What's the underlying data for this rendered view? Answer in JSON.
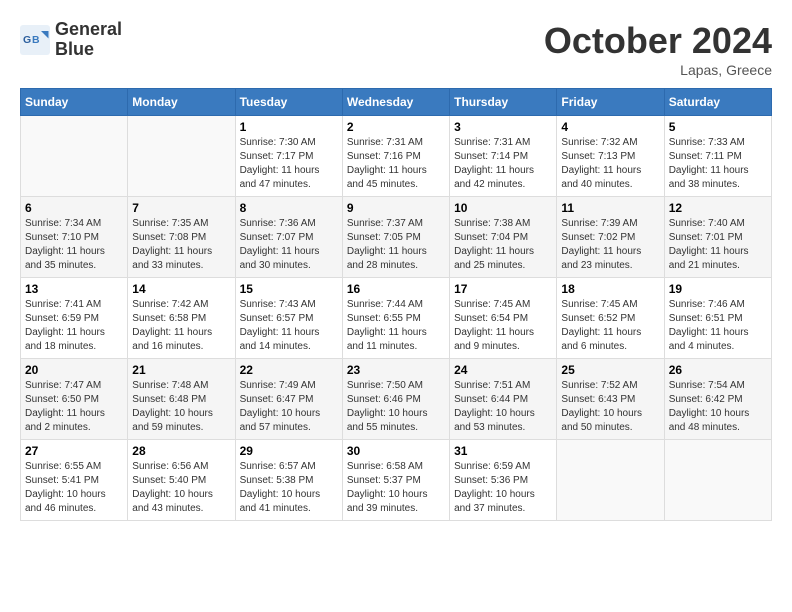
{
  "header": {
    "logo_line1": "General",
    "logo_line2": "Blue",
    "month_title": "October 2024",
    "location": "Lapas, Greece"
  },
  "weekdays": [
    "Sunday",
    "Monday",
    "Tuesday",
    "Wednesday",
    "Thursday",
    "Friday",
    "Saturday"
  ],
  "weeks": [
    [
      {
        "day": "",
        "sunrise": "",
        "sunset": "",
        "daylight": ""
      },
      {
        "day": "",
        "sunrise": "",
        "sunset": "",
        "daylight": ""
      },
      {
        "day": "1",
        "sunrise": "Sunrise: 7:30 AM",
        "sunset": "Sunset: 7:17 PM",
        "daylight": "Daylight: 11 hours and 47 minutes."
      },
      {
        "day": "2",
        "sunrise": "Sunrise: 7:31 AM",
        "sunset": "Sunset: 7:16 PM",
        "daylight": "Daylight: 11 hours and 45 minutes."
      },
      {
        "day": "3",
        "sunrise": "Sunrise: 7:31 AM",
        "sunset": "Sunset: 7:14 PM",
        "daylight": "Daylight: 11 hours and 42 minutes."
      },
      {
        "day": "4",
        "sunrise": "Sunrise: 7:32 AM",
        "sunset": "Sunset: 7:13 PM",
        "daylight": "Daylight: 11 hours and 40 minutes."
      },
      {
        "day": "5",
        "sunrise": "Sunrise: 7:33 AM",
        "sunset": "Sunset: 7:11 PM",
        "daylight": "Daylight: 11 hours and 38 minutes."
      }
    ],
    [
      {
        "day": "6",
        "sunrise": "Sunrise: 7:34 AM",
        "sunset": "Sunset: 7:10 PM",
        "daylight": "Daylight: 11 hours and 35 minutes."
      },
      {
        "day": "7",
        "sunrise": "Sunrise: 7:35 AM",
        "sunset": "Sunset: 7:08 PM",
        "daylight": "Daylight: 11 hours and 33 minutes."
      },
      {
        "day": "8",
        "sunrise": "Sunrise: 7:36 AM",
        "sunset": "Sunset: 7:07 PM",
        "daylight": "Daylight: 11 hours and 30 minutes."
      },
      {
        "day": "9",
        "sunrise": "Sunrise: 7:37 AM",
        "sunset": "Sunset: 7:05 PM",
        "daylight": "Daylight: 11 hours and 28 minutes."
      },
      {
        "day": "10",
        "sunrise": "Sunrise: 7:38 AM",
        "sunset": "Sunset: 7:04 PM",
        "daylight": "Daylight: 11 hours and 25 minutes."
      },
      {
        "day": "11",
        "sunrise": "Sunrise: 7:39 AM",
        "sunset": "Sunset: 7:02 PM",
        "daylight": "Daylight: 11 hours and 23 minutes."
      },
      {
        "day": "12",
        "sunrise": "Sunrise: 7:40 AM",
        "sunset": "Sunset: 7:01 PM",
        "daylight": "Daylight: 11 hours and 21 minutes."
      }
    ],
    [
      {
        "day": "13",
        "sunrise": "Sunrise: 7:41 AM",
        "sunset": "Sunset: 6:59 PM",
        "daylight": "Daylight: 11 hours and 18 minutes."
      },
      {
        "day": "14",
        "sunrise": "Sunrise: 7:42 AM",
        "sunset": "Sunset: 6:58 PM",
        "daylight": "Daylight: 11 hours and 16 minutes."
      },
      {
        "day": "15",
        "sunrise": "Sunrise: 7:43 AM",
        "sunset": "Sunset: 6:57 PM",
        "daylight": "Daylight: 11 hours and 14 minutes."
      },
      {
        "day": "16",
        "sunrise": "Sunrise: 7:44 AM",
        "sunset": "Sunset: 6:55 PM",
        "daylight": "Daylight: 11 hours and 11 minutes."
      },
      {
        "day": "17",
        "sunrise": "Sunrise: 7:45 AM",
        "sunset": "Sunset: 6:54 PM",
        "daylight": "Daylight: 11 hours and 9 minutes."
      },
      {
        "day": "18",
        "sunrise": "Sunrise: 7:45 AM",
        "sunset": "Sunset: 6:52 PM",
        "daylight": "Daylight: 11 hours and 6 minutes."
      },
      {
        "day": "19",
        "sunrise": "Sunrise: 7:46 AM",
        "sunset": "Sunset: 6:51 PM",
        "daylight": "Daylight: 11 hours and 4 minutes."
      }
    ],
    [
      {
        "day": "20",
        "sunrise": "Sunrise: 7:47 AM",
        "sunset": "Sunset: 6:50 PM",
        "daylight": "Daylight: 11 hours and 2 minutes."
      },
      {
        "day": "21",
        "sunrise": "Sunrise: 7:48 AM",
        "sunset": "Sunset: 6:48 PM",
        "daylight": "Daylight: 10 hours and 59 minutes."
      },
      {
        "day": "22",
        "sunrise": "Sunrise: 7:49 AM",
        "sunset": "Sunset: 6:47 PM",
        "daylight": "Daylight: 10 hours and 57 minutes."
      },
      {
        "day": "23",
        "sunrise": "Sunrise: 7:50 AM",
        "sunset": "Sunset: 6:46 PM",
        "daylight": "Daylight: 10 hours and 55 minutes."
      },
      {
        "day": "24",
        "sunrise": "Sunrise: 7:51 AM",
        "sunset": "Sunset: 6:44 PM",
        "daylight": "Daylight: 10 hours and 53 minutes."
      },
      {
        "day": "25",
        "sunrise": "Sunrise: 7:52 AM",
        "sunset": "Sunset: 6:43 PM",
        "daylight": "Daylight: 10 hours and 50 minutes."
      },
      {
        "day": "26",
        "sunrise": "Sunrise: 7:54 AM",
        "sunset": "Sunset: 6:42 PM",
        "daylight": "Daylight: 10 hours and 48 minutes."
      }
    ],
    [
      {
        "day": "27",
        "sunrise": "Sunrise: 6:55 AM",
        "sunset": "Sunset: 5:41 PM",
        "daylight": "Daylight: 10 hours and 46 minutes."
      },
      {
        "day": "28",
        "sunrise": "Sunrise: 6:56 AM",
        "sunset": "Sunset: 5:40 PM",
        "daylight": "Daylight: 10 hours and 43 minutes."
      },
      {
        "day": "29",
        "sunrise": "Sunrise: 6:57 AM",
        "sunset": "Sunset: 5:38 PM",
        "daylight": "Daylight: 10 hours and 41 minutes."
      },
      {
        "day": "30",
        "sunrise": "Sunrise: 6:58 AM",
        "sunset": "Sunset: 5:37 PM",
        "daylight": "Daylight: 10 hours and 39 minutes."
      },
      {
        "day": "31",
        "sunrise": "Sunrise: 6:59 AM",
        "sunset": "Sunset: 5:36 PM",
        "daylight": "Daylight: 10 hours and 37 minutes."
      },
      {
        "day": "",
        "sunrise": "",
        "sunset": "",
        "daylight": ""
      },
      {
        "day": "",
        "sunrise": "",
        "sunset": "",
        "daylight": ""
      }
    ]
  ]
}
